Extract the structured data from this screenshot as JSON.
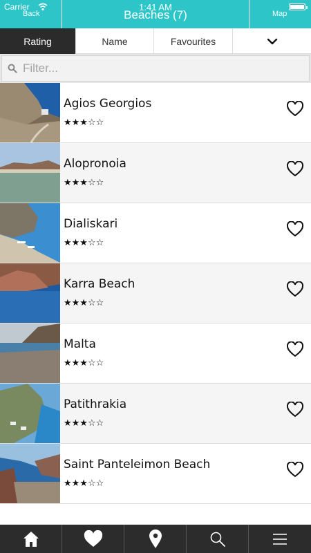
{
  "status_bar": {
    "carrier": "Carrier",
    "time": "1:41 AM"
  },
  "header": {
    "title": "Beaches (7)",
    "back_label": "Back",
    "map_label": "Map"
  },
  "sort_tabs": [
    {
      "label": "Rating",
      "active": true
    },
    {
      "label": "Name",
      "active": false
    },
    {
      "label": "Favourites",
      "active": false
    }
  ],
  "filter": {
    "placeholder": "Filter...",
    "value": ""
  },
  "beaches": [
    {
      "name": "Agios Georgios",
      "stars": "★★★☆☆",
      "rating": 3
    },
    {
      "name": "Alopronoia",
      "stars": "★★★☆☆",
      "rating": 3
    },
    {
      "name": "Dialiskari",
      "stars": "★★★☆☆",
      "rating": 3
    },
    {
      "name": "Karra Beach",
      "stars": "★★★☆☆",
      "rating": 3
    },
    {
      "name": "Malta",
      "stars": "★★★☆☆",
      "rating": 3
    },
    {
      "name": "Patithrakia",
      "stars": "★★★☆☆",
      "rating": 3
    },
    {
      "name": "Saint Panteleimon Beach",
      "stars": "★★★☆☆",
      "rating": 3
    }
  ],
  "bottom_nav": [
    {
      "icon": "home-icon"
    },
    {
      "icon": "heart-icon"
    },
    {
      "icon": "location-pin-icon"
    },
    {
      "icon": "search-icon"
    },
    {
      "icon": "menu-icon"
    }
  ],
  "colors": {
    "accent": "#2ec5c9",
    "dark": "#2b2b2b"
  }
}
